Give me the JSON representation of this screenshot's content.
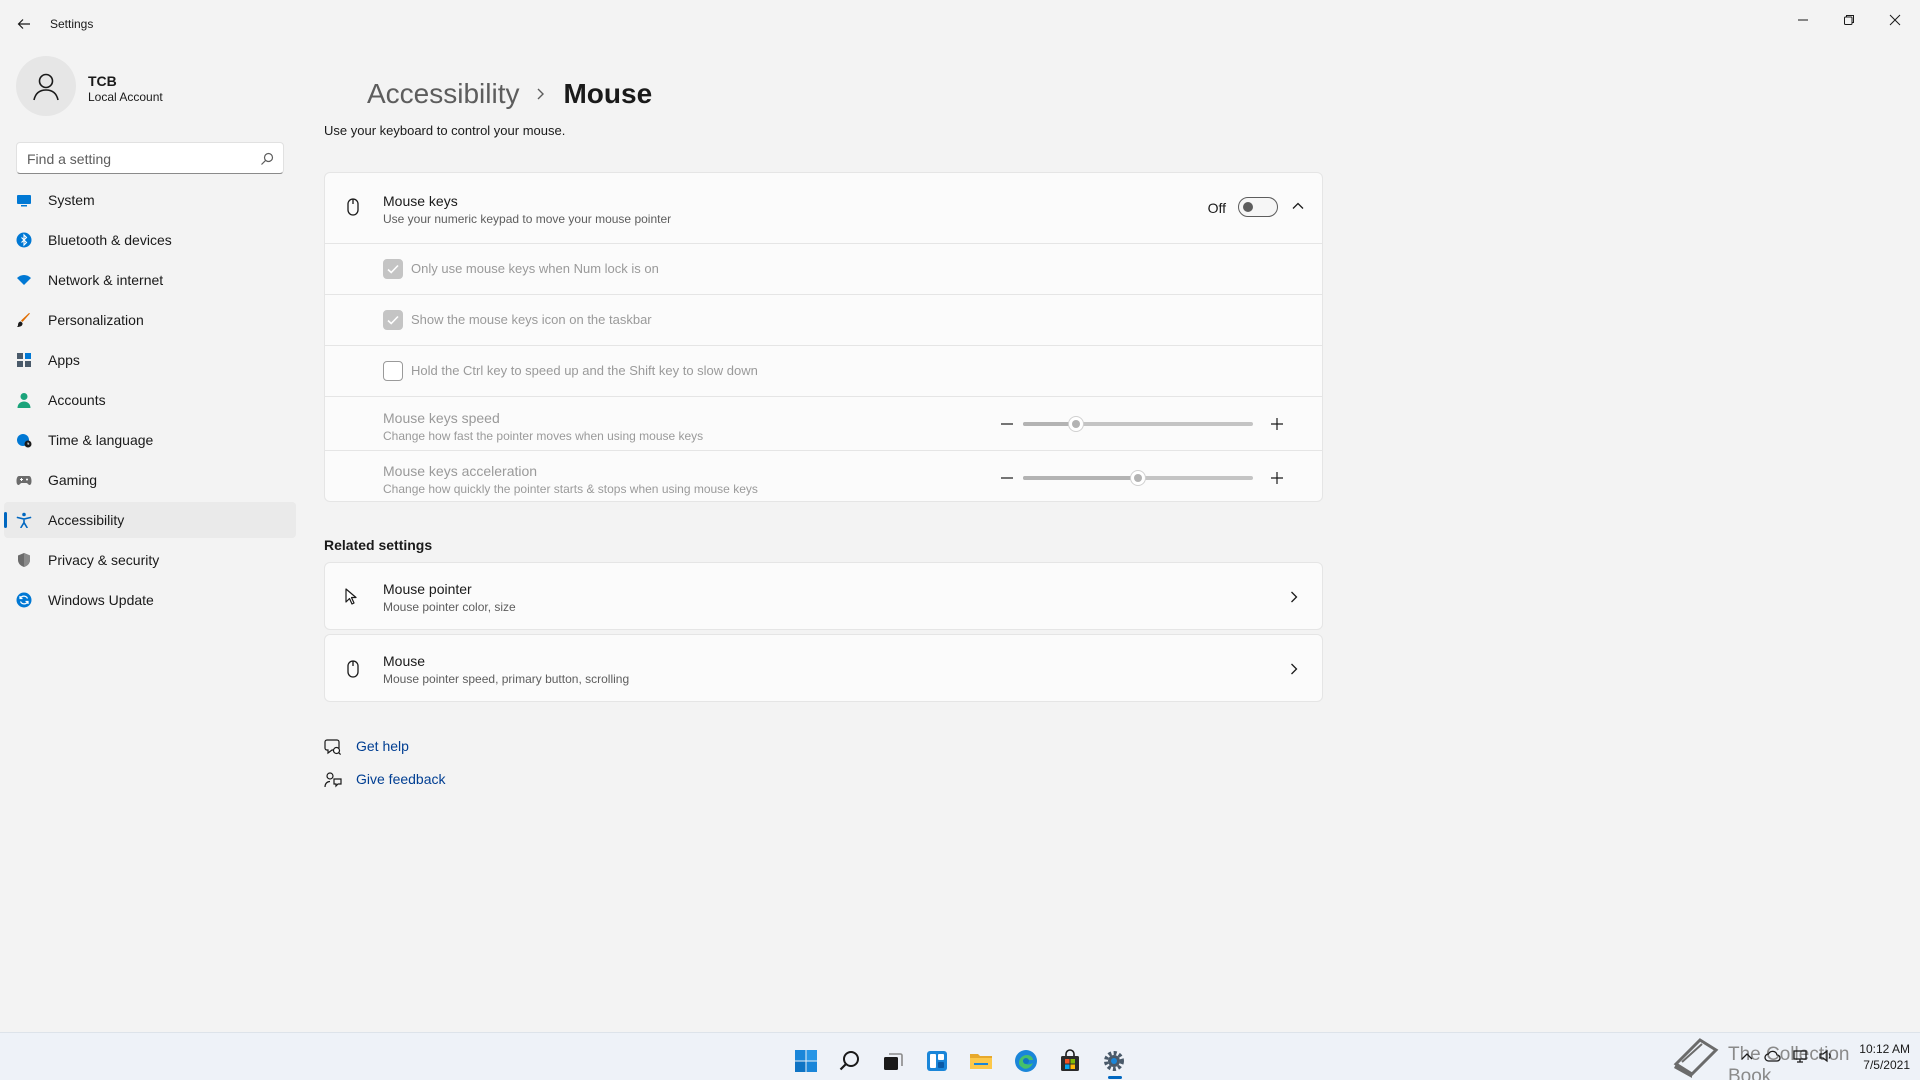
{
  "window": {
    "title": "Settings"
  },
  "profile": {
    "name": "TCB",
    "account_type": "Local Account"
  },
  "search": {
    "placeholder": "Find a setting"
  },
  "nav": {
    "items": [
      {
        "label": "System",
        "color": "#0078d4"
      },
      {
        "label": "Bluetooth & devices",
        "color": "#0078d4"
      },
      {
        "label": "Network & internet",
        "color": "#0078d4"
      },
      {
        "label": "Personalization",
        "color": "#e06c00"
      },
      {
        "label": "Apps",
        "color": "#4a5a6a"
      },
      {
        "label": "Accounts",
        "color": "#1aa37a"
      },
      {
        "label": "Time & language",
        "color": "#0078d4"
      },
      {
        "label": "Gaming",
        "color": "#6b6b6b"
      },
      {
        "label": "Accessibility",
        "color": "#0067c0"
      },
      {
        "label": "Privacy & security",
        "color": "#6b6b6b"
      },
      {
        "label": "Windows Update",
        "color": "#0078d4"
      }
    ],
    "active_index": 8
  },
  "breadcrumb": {
    "parent": "Accessibility",
    "current": "Mouse"
  },
  "page": {
    "description": "Use your keyboard to control your mouse."
  },
  "mouse_keys": {
    "title": "Mouse keys",
    "subtitle": "Use your numeric keypad to move your mouse pointer",
    "state_label": "Off",
    "enabled": false,
    "options": [
      {
        "label": "Only use mouse keys when Num lock is on",
        "checked": true
      },
      {
        "label": "Show the mouse keys icon on the taskbar",
        "checked": true
      },
      {
        "label": "Hold the Ctrl key to speed up and the Shift key to slow down",
        "checked": false
      }
    ],
    "speed": {
      "title": "Mouse keys speed",
      "subtitle": "Change how fast the pointer moves when using mouse keys",
      "value": 0.23
    },
    "acceleration": {
      "title": "Mouse keys acceleration",
      "subtitle": "Change how quickly the pointer starts & stops when using mouse keys",
      "value": 0.5
    }
  },
  "related": {
    "title": "Related settings",
    "items": [
      {
        "title": "Mouse pointer",
        "subtitle": "Mouse pointer color, size"
      },
      {
        "title": "Mouse",
        "subtitle": "Mouse pointer speed, primary button, scrolling"
      }
    ]
  },
  "help": {
    "get_help": "Get help",
    "give_feedback": "Give feedback"
  },
  "taskbar": {
    "time": "10:12 AM",
    "date": "7/5/2021"
  },
  "watermark": {
    "text": "The Collection Book"
  },
  "colors": {
    "accent": "#0067c0",
    "link": "#003e92"
  }
}
